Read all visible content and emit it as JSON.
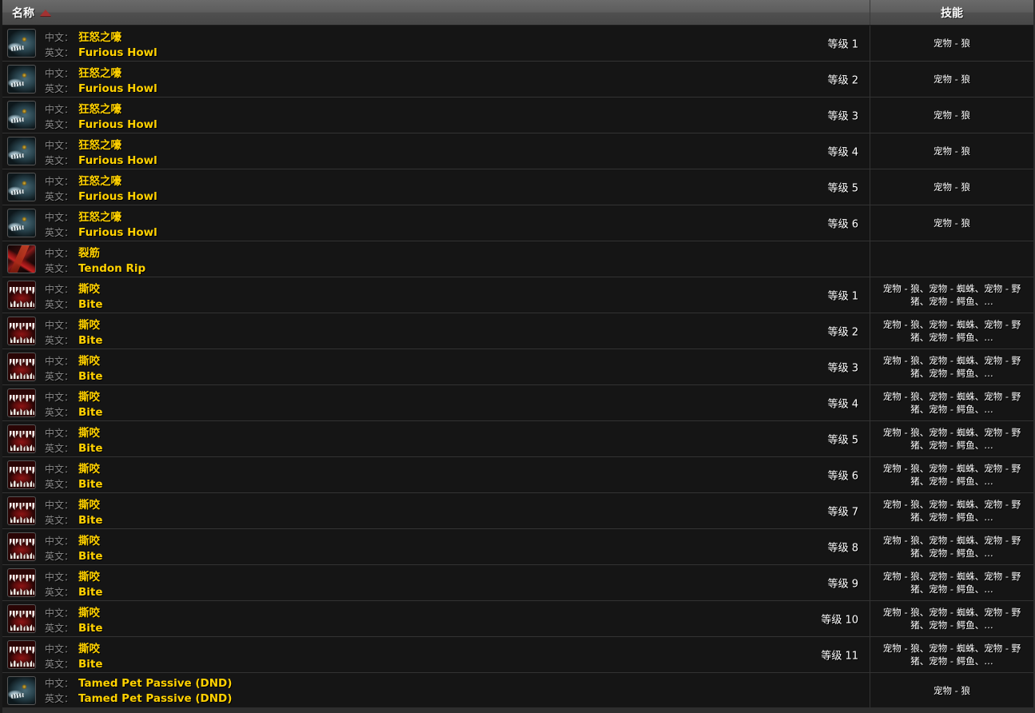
{
  "header": {
    "name_column_label": "名称",
    "skill_column_label": "技能",
    "sort_icon": "sort-ascending-triangle-icon",
    "sort_direction": "ascending"
  },
  "labels": {
    "chinese_label": "中文：",
    "english_label": "英文："
  },
  "colors": {
    "header_bg": "#5d5d5d",
    "row_bg": "#151515",
    "row_border": "#333333",
    "value_text": "#ffd100",
    "label_text": "#8a8a8a",
    "sort_arrow": "#a33232",
    "plain_text": "#ffffff"
  },
  "skill_groups": {
    "wolf_only": "宠物 - 狼",
    "multi_pet": "宠物 - 狼、宠物 - 蜘蛛、宠物 - 野猪、宠物 - 鳄鱼、…",
    "empty": ""
  },
  "rows": [
    {
      "icon": "wolf-head-icon",
      "icon_class": "icon-wolf",
      "chinese": "狂怒之嚎",
      "english": "Furious Howl",
      "rank": "等级 1",
      "skill": "宠物 - 狼"
    },
    {
      "icon": "wolf-head-icon",
      "icon_class": "icon-wolf",
      "chinese": "狂怒之嚎",
      "english": "Furious Howl",
      "rank": "等级 2",
      "skill": "宠物 - 狼"
    },
    {
      "icon": "wolf-head-icon",
      "icon_class": "icon-wolf",
      "chinese": "狂怒之嚎",
      "english": "Furious Howl",
      "rank": "等级 3",
      "skill": "宠物 - 狼"
    },
    {
      "icon": "wolf-head-icon",
      "icon_class": "icon-wolf",
      "chinese": "狂怒之嚎",
      "english": "Furious Howl",
      "rank": "等级 4",
      "skill": "宠物 - 狼"
    },
    {
      "icon": "wolf-head-icon",
      "icon_class": "icon-wolf",
      "chinese": "狂怒之嚎",
      "english": "Furious Howl",
      "rank": "等级 5",
      "skill": "宠物 - 狼"
    },
    {
      "icon": "wolf-head-icon",
      "icon_class": "icon-wolf",
      "chinese": "狂怒之嚎",
      "english": "Furious Howl",
      "rank": "等级 6",
      "skill": "宠物 - 狼"
    },
    {
      "icon": "tendon-rip-icon",
      "icon_class": "icon-tendon",
      "chinese": "裂筋",
      "english": "Tendon Rip",
      "rank": "",
      "skill": ""
    },
    {
      "icon": "bite-jaws-icon",
      "icon_class": "icon-bite",
      "chinese": "撕咬",
      "english": "Bite",
      "rank": "等级 1",
      "skill": "宠物 - 狼、宠物 - 蜘蛛、宠物 - 野猪、宠物 - 鳄鱼、…"
    },
    {
      "icon": "bite-jaws-icon",
      "icon_class": "icon-bite",
      "chinese": "撕咬",
      "english": "Bite",
      "rank": "等级 2",
      "skill": "宠物 - 狼、宠物 - 蜘蛛、宠物 - 野猪、宠物 - 鳄鱼、…"
    },
    {
      "icon": "bite-jaws-icon",
      "icon_class": "icon-bite",
      "chinese": "撕咬",
      "english": "Bite",
      "rank": "等级 3",
      "skill": "宠物 - 狼、宠物 - 蜘蛛、宠物 - 野猪、宠物 - 鳄鱼、…"
    },
    {
      "icon": "bite-jaws-icon",
      "icon_class": "icon-bite",
      "chinese": "撕咬",
      "english": "Bite",
      "rank": "等级 4",
      "skill": "宠物 - 狼、宠物 - 蜘蛛、宠物 - 野猪、宠物 - 鳄鱼、…"
    },
    {
      "icon": "bite-jaws-icon",
      "icon_class": "icon-bite",
      "chinese": "撕咬",
      "english": "Bite",
      "rank": "等级 5",
      "skill": "宠物 - 狼、宠物 - 蜘蛛、宠物 - 野猪、宠物 - 鳄鱼、…"
    },
    {
      "icon": "bite-jaws-icon",
      "icon_class": "icon-bite",
      "chinese": "撕咬",
      "english": "Bite",
      "rank": "等级 6",
      "skill": "宠物 - 狼、宠物 - 蜘蛛、宠物 - 野猪、宠物 - 鳄鱼、…"
    },
    {
      "icon": "bite-jaws-icon",
      "icon_class": "icon-bite",
      "chinese": "撕咬",
      "english": "Bite",
      "rank": "等级 7",
      "skill": "宠物 - 狼、宠物 - 蜘蛛、宠物 - 野猪、宠物 - 鳄鱼、…"
    },
    {
      "icon": "bite-jaws-icon",
      "icon_class": "icon-bite",
      "chinese": "撕咬",
      "english": "Bite",
      "rank": "等级 8",
      "skill": "宠物 - 狼、宠物 - 蜘蛛、宠物 - 野猪、宠物 - 鳄鱼、…"
    },
    {
      "icon": "bite-jaws-icon",
      "icon_class": "icon-bite",
      "chinese": "撕咬",
      "english": "Bite",
      "rank": "等级 9",
      "skill": "宠物 - 狼、宠物 - 蜘蛛、宠物 - 野猪、宠物 - 鳄鱼、…"
    },
    {
      "icon": "bite-jaws-icon",
      "icon_class": "icon-bite",
      "chinese": "撕咬",
      "english": "Bite",
      "rank": "等级 10",
      "skill": "宠物 - 狼、宠物 - 蜘蛛、宠物 - 野猪、宠物 - 鳄鱼、…"
    },
    {
      "icon": "bite-jaws-icon",
      "icon_class": "icon-bite",
      "chinese": "撕咬",
      "english": "Bite",
      "rank": "等级 11",
      "skill": "宠物 - 狼、宠物 - 蜘蛛、宠物 - 野猪、宠物 - 鳄鱼、…"
    },
    {
      "icon": "wolf-head-icon",
      "icon_class": "icon-wolf",
      "chinese": "Tamed Pet Passive (DND)",
      "english": "Tamed Pet Passive (DND)",
      "rank": "",
      "skill": "宠物 - 狼"
    }
  ]
}
